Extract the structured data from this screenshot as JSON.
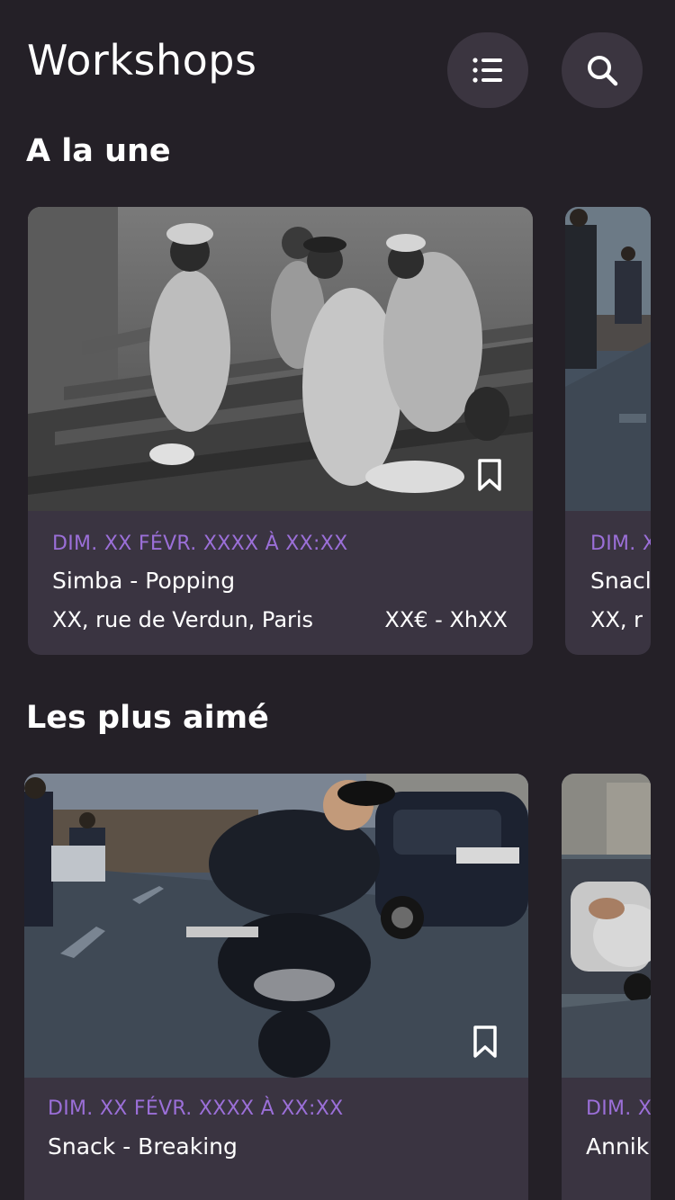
{
  "header": {
    "title": "Workshops",
    "list_button_icon": "list-icon",
    "search_button_icon": "search-icon"
  },
  "sections": [
    {
      "title": "A la une",
      "cards": [
        {
          "date": "DIM. XX FÉVR. XXXX À XX:XX",
          "name": "Simba - Popping",
          "address": "XX, rue de Verdun, Paris",
          "price": "XX€ - XhXX",
          "bookmark_icon": "bookmark-icon"
        },
        {
          "date": "DIM. X",
          "name": "Snacl",
          "address": "XX, r"
        }
      ]
    },
    {
      "title": "Les plus aimé",
      "cards": [
        {
          "date": "DIM. XX FÉVR. XXXX À XX:XX",
          "name": "Snack - Breaking",
          "bookmark_icon": "bookmark-icon"
        },
        {
          "date": "DIM. X",
          "name": "Annik"
        }
      ]
    }
  ],
  "colors": {
    "background": "#242027",
    "card": "#3a3441",
    "button": "#3b3540",
    "accent_date": "#9b6fd8"
  }
}
